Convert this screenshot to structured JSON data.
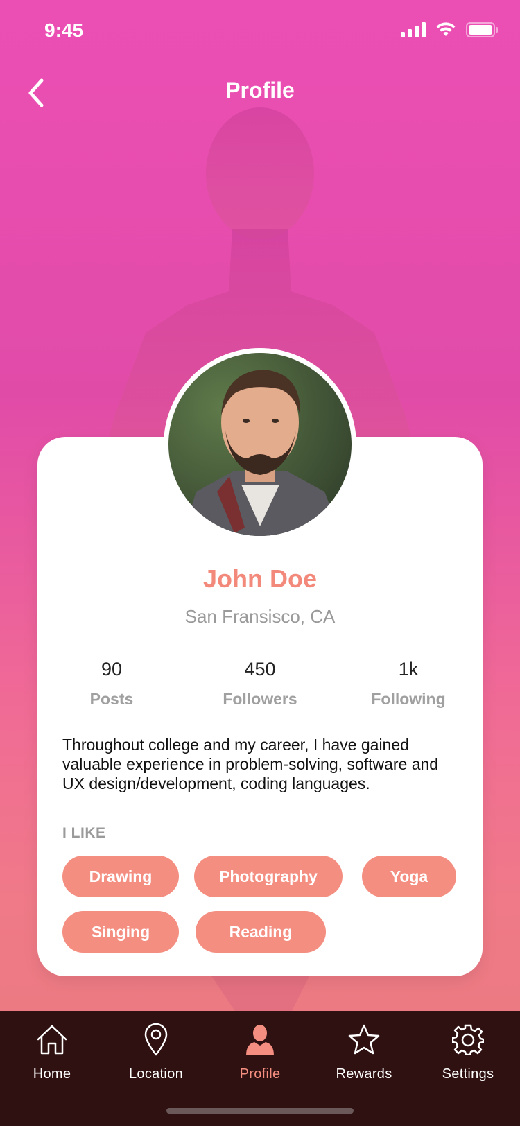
{
  "status_bar": {
    "time": "9:45"
  },
  "nav": {
    "title": "Profile"
  },
  "profile": {
    "name": "John Doe",
    "location": "San Fransisco, CA",
    "stats": [
      {
        "value": "90",
        "label": "Posts"
      },
      {
        "value": "450",
        "label": "Followers"
      },
      {
        "value": "1k",
        "label": "Following"
      }
    ],
    "bio": "Throughout college and my career, I have gained valuable experience in problem-solving, software and UX design/development, coding languages.",
    "likes_heading": "I LIKE",
    "tags": [
      "Drawing",
      "Photography",
      "Yoga",
      "Singing",
      "Reading"
    ]
  },
  "tab_bar": {
    "items": [
      {
        "label": "Home",
        "icon": "home-icon",
        "active": false
      },
      {
        "label": "Location",
        "icon": "location-pin-icon",
        "active": false
      },
      {
        "label": "Profile",
        "icon": "person-icon",
        "active": true
      },
      {
        "label": "Rewards",
        "icon": "star-icon",
        "active": false
      },
      {
        "label": "Settings",
        "icon": "gear-icon",
        "active": false
      }
    ]
  },
  "colors": {
    "accent": "#f48e80",
    "name": "#f2897a",
    "tab_bar_bg": "#2e1110",
    "background_top": "#ec4fb4",
    "background_bottom": "#e77b7d"
  }
}
